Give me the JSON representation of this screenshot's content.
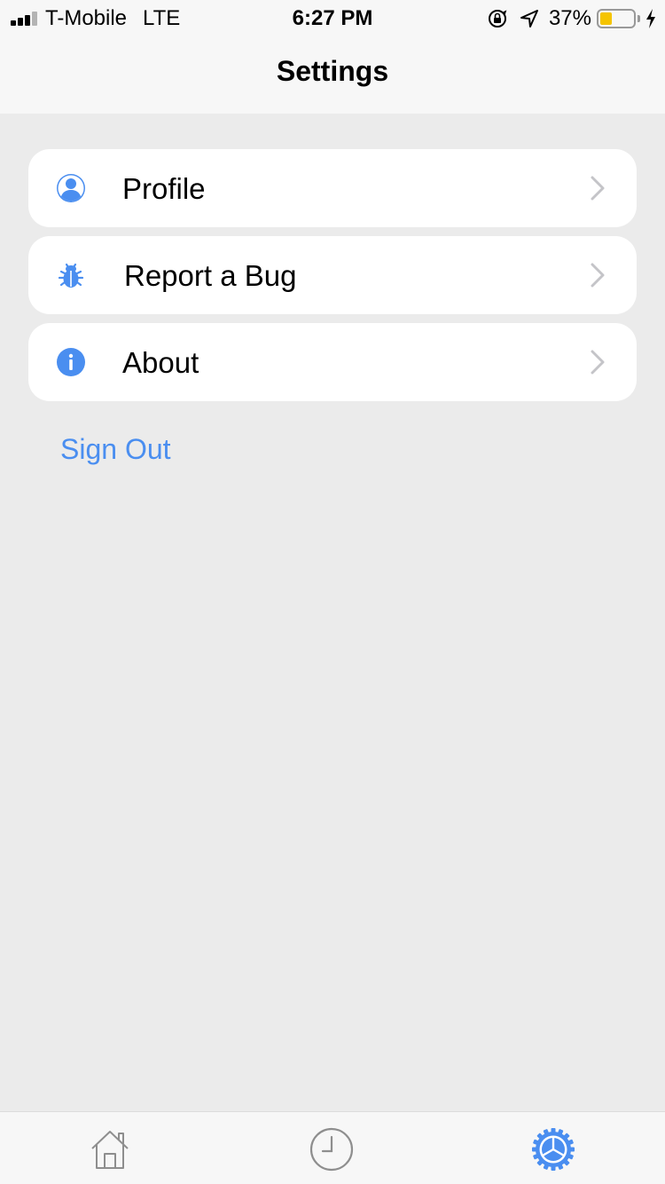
{
  "status_bar": {
    "carrier": "T-Mobile",
    "network": "LTE",
    "time": "6:27 PM",
    "battery_percent": "37%",
    "battery_level": 0.37,
    "battery_color": "#f5c400",
    "signal_bars": 3
  },
  "nav": {
    "title": "Settings"
  },
  "menu": {
    "items": [
      {
        "label": "Profile",
        "icon": "user-icon"
      },
      {
        "label": "Report a Bug",
        "icon": "bug-icon"
      },
      {
        "label": "About",
        "icon": "info-icon"
      }
    ]
  },
  "sign_out": {
    "label": "Sign Out"
  },
  "tabbar": {
    "tabs": [
      {
        "icon": "home-icon",
        "active": false
      },
      {
        "icon": "clock-icon",
        "active": false
      },
      {
        "icon": "gear-icon",
        "active": true
      }
    ]
  },
  "colors": {
    "accent": "#4a8ef0",
    "background": "#ebebeb",
    "card": "#ffffff",
    "chevron": "#c4c4c8",
    "inactive_tab": "#8e8e8e"
  }
}
